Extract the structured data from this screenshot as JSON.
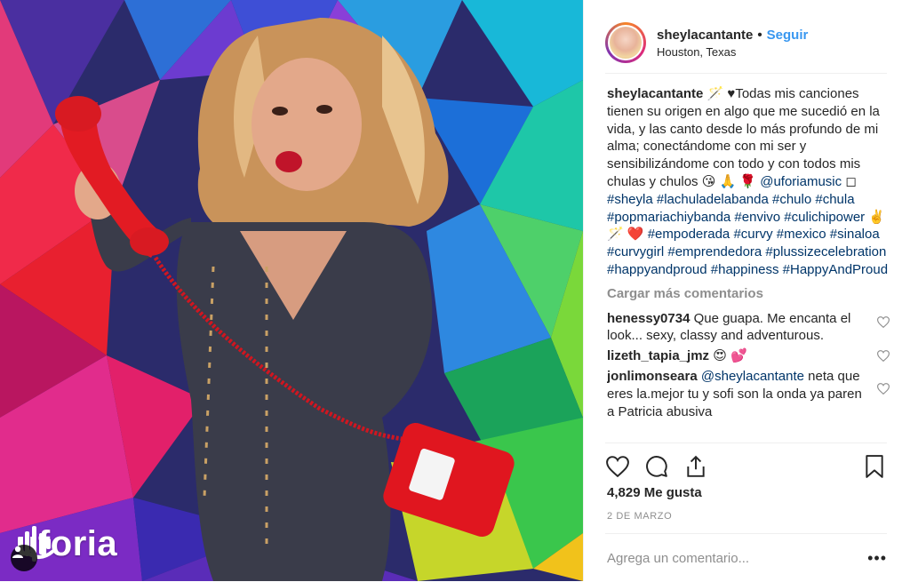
{
  "post": {
    "brand_logo_text": "uforia"
  },
  "header": {
    "username": "sheylacantante",
    "separator": "•",
    "follow_label": "Seguir",
    "location": "Houston, Texas"
  },
  "caption": {
    "username": "sheylacantante",
    "text": "🪄 ♥Todas mis canciones tienen su origen en algo que me sucedió en la vida, y las canto desde lo más profundo de mi alma; conectándome con mi ser y sensibilizándome con todo y con todos mis chulas y chulos 😘 🙏 🌹 ",
    "mention": "@uforiamusic",
    "mention_suffix": " ◻",
    "tags_line1": "#sheyla #lachuladelabanda #chulo #chula #popmariachiybanda #envivo #culichipower",
    "emoji_line": "✌️ 🪄 ❤️ ",
    "tags_line2": "#empoderada #curvy #mexico #sinaloa #curvygirl #emprendedora #plussizecelebration #happyandproud #happiness #HappyAndProud"
  },
  "load_more_label": "Cargar más comentarios",
  "comments": [
    {
      "username": "henessy0734",
      "text": " Que guapa. Me encanta el look... sexy, classy and adventurous."
    },
    {
      "username": "lizeth_tapia_jmz",
      "text": " 😍 💕"
    },
    {
      "username": "jonlimonseara",
      "mention": " @sheylacantante",
      "text": " neta que eres la.mejor tu y sofi son la onda ya paren a Patricia abusiva"
    }
  ],
  "likes_text": "4,829 Me gusta",
  "date_text": "2 DE MARZO",
  "add_comment": {
    "placeholder": "Agrega un comentario...",
    "more_label": "•••"
  },
  "icons": {
    "like": "heart-icon",
    "comment": "comment-icon",
    "share": "share-icon",
    "save": "bookmark-icon",
    "user_tags": "user-icon"
  },
  "colors": {
    "accent": "#3897f0",
    "hashtag": "#003569",
    "muted": "#8e8e8e"
  }
}
